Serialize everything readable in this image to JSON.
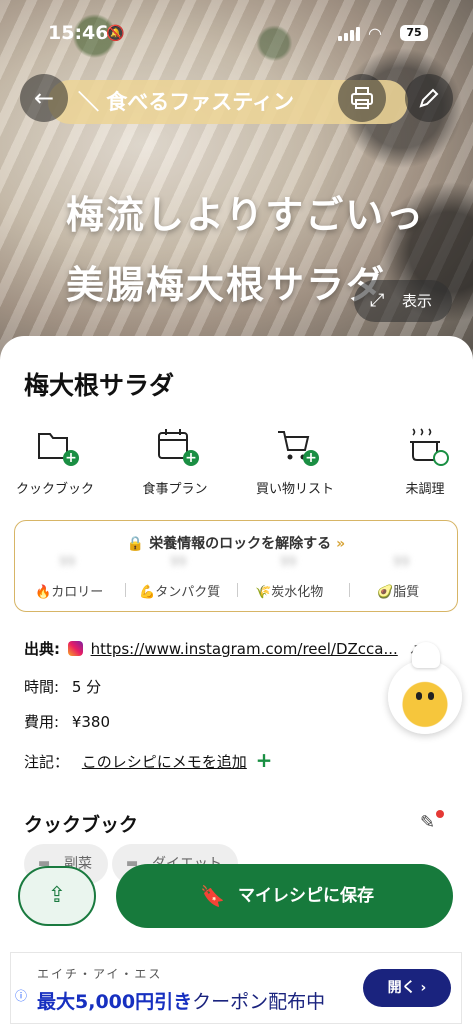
{
  "status": {
    "time": "15:46",
    "battery": "75"
  },
  "hero": {
    "banner": "＼ 食べるファスティン",
    "title_line1": "梅流しよりすごいっ",
    "title_line2": "美腸梅大根サラダ",
    "show_label": "表示"
  },
  "recipe": {
    "title": "梅大根サラダ"
  },
  "actions": [
    {
      "label": "クックブック",
      "icon": "folder-add-icon"
    },
    {
      "label": "食事プラン",
      "icon": "calendar-add-icon"
    },
    {
      "label": "買い物リスト",
      "icon": "cart-add-icon"
    },
    {
      "label": "未調理",
      "icon": "pot-icon"
    }
  ],
  "nutrition": {
    "unlock_label": "栄養情報のロックを解除する",
    "unlock_arrow": "»",
    "labels": [
      "カロリー",
      "タンパク質",
      "炭水化物",
      "脂質"
    ],
    "blurred": [
      "99",
      "99",
      "99",
      "99"
    ]
  },
  "details": {
    "source_label": "出典:",
    "source_url": "https://www.instagram.com/reel/DZcca...",
    "time_label": "時間:",
    "time_value": "5 分",
    "cost_label": "費用:",
    "cost_value": "¥380",
    "note_label": "注記：",
    "note_link": "このレシピにメモを追加",
    "note_plus": "+"
  },
  "cookbook": {
    "heading": "クックブック",
    "chips": [
      "副菜",
      "ダイエット"
    ]
  },
  "bottom": {
    "save_label": "マイレシピに保存"
  },
  "ad": {
    "company": "エイチ・アイ・エス",
    "headline_strong": "最大5,000円引き",
    "headline_rest": "クーポン配布中",
    "cta": "開く ›"
  },
  "colors": {
    "primary": "#177a3c",
    "gold_border": "#d7b566",
    "ad_navy": "#1a237e"
  }
}
